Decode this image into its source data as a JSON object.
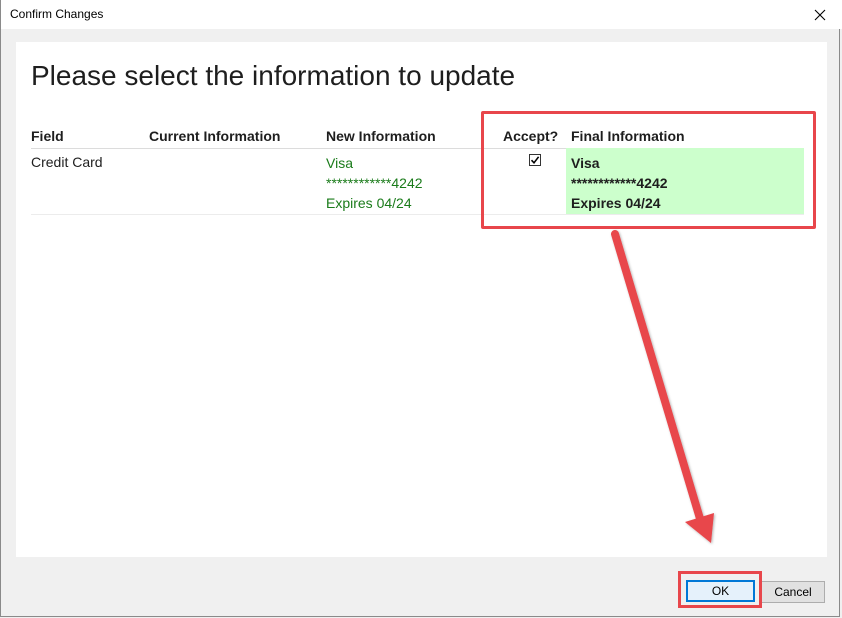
{
  "window": {
    "title": "Confirm Changes",
    "close_icon": "close-icon"
  },
  "heading": "Please select the information to update",
  "table": {
    "headers": {
      "field": "Field",
      "current": "Current Information",
      "new": "New Information",
      "accept": "Accept?",
      "final": "Final Information"
    },
    "rows": [
      {
        "field": "Credit Card",
        "current": "",
        "new_lines": [
          "Visa",
          "************4242",
          "Expires 04/24"
        ],
        "accepted": true,
        "final_lines": [
          "Visa",
          "************4242",
          "Expires 04/24"
        ]
      }
    ]
  },
  "buttons": {
    "ok": "OK",
    "cancel": "Cancel"
  },
  "colors": {
    "new_info_text": "#1a7b1a",
    "final_info_bg": "#ccffcc",
    "annotation_red": "#e8464b",
    "ok_border": "#0078d7"
  }
}
